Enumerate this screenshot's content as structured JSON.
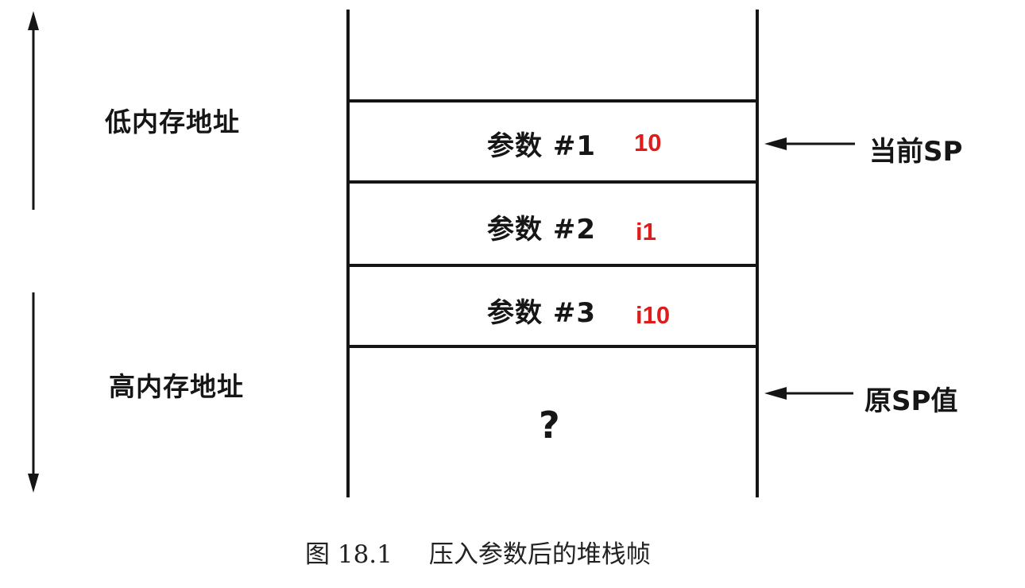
{
  "stack": {
    "slots": [
      {
        "label": "参数 #1",
        "value": "10"
      },
      {
        "label": "参数 #2",
        "value": "i1"
      },
      {
        "label": "参数 #3",
        "value": "i10"
      }
    ],
    "unknown_slot": "?"
  },
  "pointers": {
    "current_sp": "当前SP",
    "original_sp": "原SP值"
  },
  "memory_direction": {
    "low": "低内存地址",
    "high": "高内存地址"
  },
  "caption": {
    "number": "图 18.1",
    "text": "压入参数后的堆栈帧"
  },
  "colors": {
    "annotation": "#e01b1b",
    "ink": "#151515"
  }
}
